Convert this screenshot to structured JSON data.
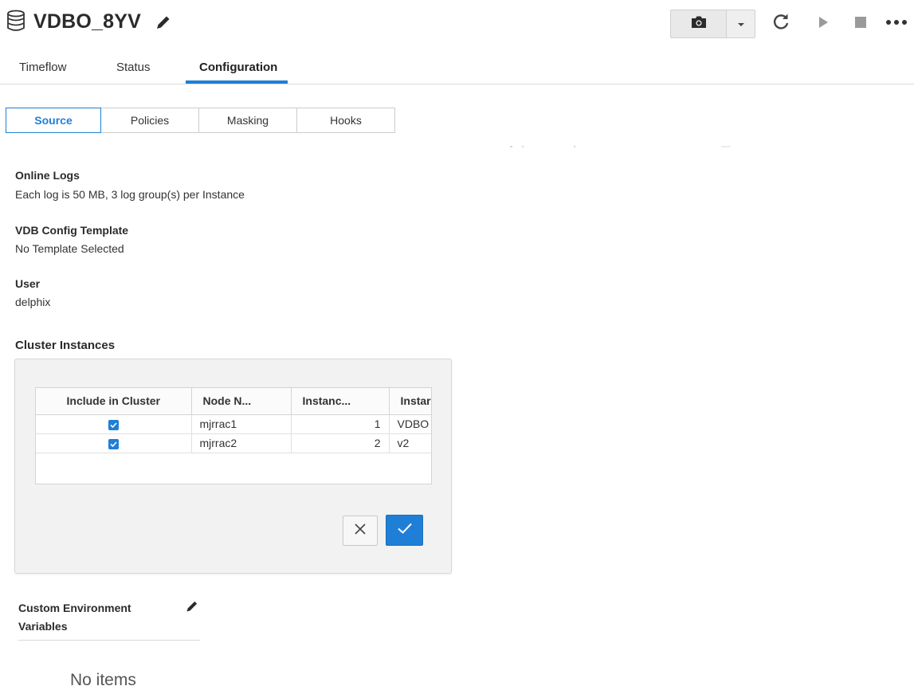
{
  "header": {
    "title": "VDBO_8YV",
    "icons": [
      "database-icon",
      "pencil-icon",
      "camera-icon",
      "caret-down-icon",
      "refresh-icon",
      "play-icon",
      "stop-icon",
      "more-icon"
    ]
  },
  "main_tabs": [
    {
      "label": "Timeflow",
      "active": false
    },
    {
      "label": "Status",
      "active": false
    },
    {
      "label": "Configuration",
      "active": true
    }
  ],
  "sub_tabs": [
    {
      "label": "Source",
      "active": true
    },
    {
      "label": "Policies",
      "active": false
    },
    {
      "label": "Masking",
      "active": false
    },
    {
      "label": "Hooks",
      "active": false
    }
  ],
  "sections": {
    "online_logs": {
      "label": "Online Logs",
      "value": "Each log is 50 MB, 3 log group(s) per Instance"
    },
    "vdb_template": {
      "label": "VDB Config Template",
      "value": "No Template Selected"
    },
    "user": {
      "label": "User",
      "value": "delphix"
    },
    "cluster_instances": {
      "label": "Cluster Instances"
    }
  },
  "cluster_table": {
    "columns": [
      "Include in Cluster",
      "Node N...",
      "Instanc...",
      "Instar"
    ],
    "rows": [
      {
        "include": true,
        "node": "mjrrac1",
        "instance_num": "1",
        "instance_name": "VDBO"
      },
      {
        "include": true,
        "node": "mjrrac2",
        "instance_num": "2",
        "instance_name": "v2"
      }
    ]
  },
  "custom_env": {
    "label": "Custom Environment Variables",
    "empty_text": "No items"
  },
  "colors": {
    "accent": "#1f7fd6",
    "panel_bg": "#f2f2f2",
    "border": "#d4d4d4"
  }
}
